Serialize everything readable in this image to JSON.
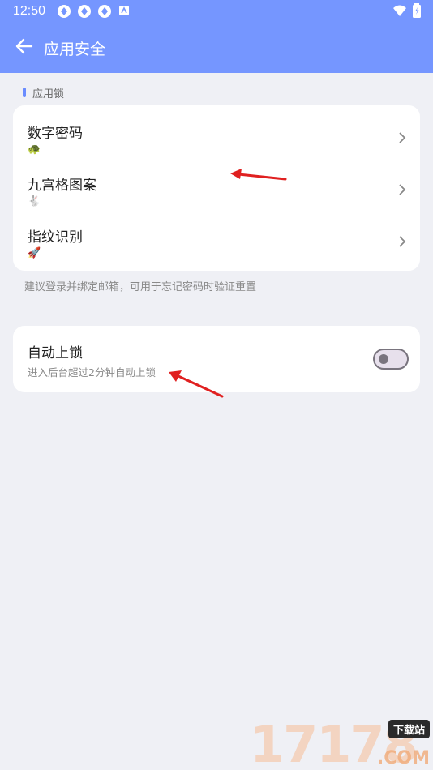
{
  "status_bar": {
    "time": "12:50",
    "notification_icons": [
      "sync-icon",
      "sync-icon",
      "sync-icon",
      "android-icon"
    ],
    "right_icons": [
      "wifi-icon",
      "battery-icon"
    ]
  },
  "toolbar": {
    "title": "应用安全",
    "back_icon": "arrow-left-icon"
  },
  "sections": {
    "lock_header": "应用锁"
  },
  "lock_options": [
    {
      "label": "数字密码",
      "emoji": "🐢"
    },
    {
      "label": "九宫格图案",
      "emoji": "🐇"
    },
    {
      "label": "指纹识别",
      "emoji": "🚀"
    }
  ],
  "hint": "建议登录并绑定邮箱，可用于忘记密码时验证重置",
  "auto_lock": {
    "title": "自动上锁",
    "description": "进入后台超过2分钟自动上锁",
    "enabled": false
  },
  "watermark": {
    "digits": "17178",
    "tag": "下载站",
    "domain": ".COM"
  },
  "colors": {
    "appbar": "#7596ff",
    "background": "#eff0f5",
    "accent": "#6a8cff",
    "annotation_arrow": "#e02020"
  }
}
